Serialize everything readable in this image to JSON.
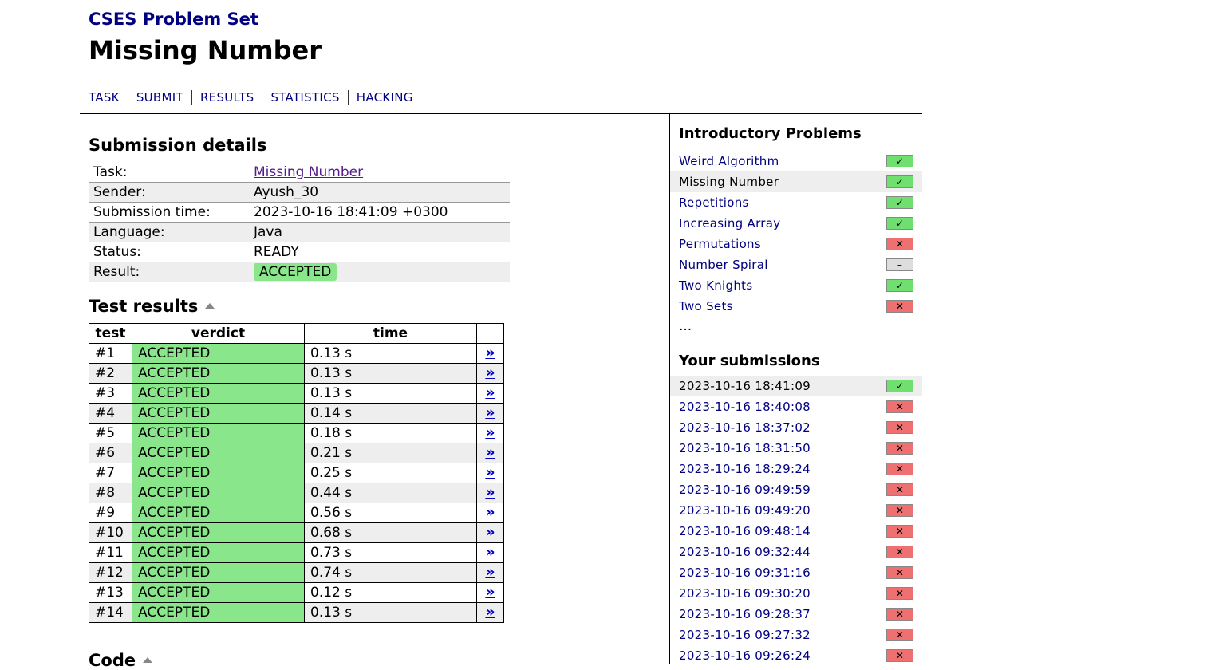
{
  "header": {
    "site_title": "CSES Problem Set",
    "page_title": "Missing Number"
  },
  "nav": [
    {
      "label": "TASK"
    },
    {
      "label": "SUBMIT"
    },
    {
      "label": "RESULTS"
    },
    {
      "label": "STATISTICS"
    },
    {
      "label": "HACKING"
    }
  ],
  "details": {
    "heading": "Submission details",
    "task_label": "Task:",
    "task_value": "Missing Number",
    "sender_label": "Sender:",
    "sender_value": "Ayush_30",
    "time_label": "Submission time:",
    "time_value": "2023-10-16 18:41:09 +0300",
    "language_label": "Language:",
    "language_value": "Java",
    "status_label": "Status:",
    "status_value": "READY",
    "result_label": "Result:",
    "result_value": "ACCEPTED"
  },
  "tests": {
    "heading": "Test results",
    "columns": {
      "test": "test",
      "verdict": "verdict",
      "time": "time"
    },
    "link_glyph": "»",
    "rows": [
      {
        "test": "#1",
        "verdict": "ACCEPTED",
        "time": "0.13 s"
      },
      {
        "test": "#2",
        "verdict": "ACCEPTED",
        "time": "0.13 s"
      },
      {
        "test": "#3",
        "verdict": "ACCEPTED",
        "time": "0.13 s"
      },
      {
        "test": "#4",
        "verdict": "ACCEPTED",
        "time": "0.14 s"
      },
      {
        "test": "#5",
        "verdict": "ACCEPTED",
        "time": "0.18 s"
      },
      {
        "test": "#6",
        "verdict": "ACCEPTED",
        "time": "0.21 s"
      },
      {
        "test": "#7",
        "verdict": "ACCEPTED",
        "time": "0.25 s"
      },
      {
        "test": "#8",
        "verdict": "ACCEPTED",
        "time": "0.44 s"
      },
      {
        "test": "#9",
        "verdict": "ACCEPTED",
        "time": "0.56 s"
      },
      {
        "test": "#10",
        "verdict": "ACCEPTED",
        "time": "0.68 s"
      },
      {
        "test": "#11",
        "verdict": "ACCEPTED",
        "time": "0.73 s"
      },
      {
        "test": "#12",
        "verdict": "ACCEPTED",
        "time": "0.74 s"
      },
      {
        "test": "#13",
        "verdict": "ACCEPTED",
        "time": "0.12 s"
      },
      {
        "test": "#14",
        "verdict": "ACCEPTED",
        "time": "0.13 s"
      }
    ]
  },
  "code": {
    "heading": "Code"
  },
  "sidebar": {
    "problems_heading": "Introductory Problems",
    "problems": [
      {
        "name": "Weird Algorithm",
        "status": "solved"
      },
      {
        "name": "Missing Number",
        "status": "solved"
      },
      {
        "name": "Repetitions",
        "status": "solved"
      },
      {
        "name": "Increasing Array",
        "status": "solved"
      },
      {
        "name": "Permutations",
        "status": "failed"
      },
      {
        "name": "Number Spiral",
        "status": "none"
      },
      {
        "name": "Two Knights",
        "status": "solved"
      },
      {
        "name": "Two Sets",
        "status": "failed"
      }
    ],
    "more": "...",
    "submissions_heading": "Your submissions",
    "submissions": [
      {
        "time": "2023-10-16 18:41:09",
        "status": "solved"
      },
      {
        "time": "2023-10-16 18:40:08",
        "status": "failed"
      },
      {
        "time": "2023-10-16 18:37:02",
        "status": "failed"
      },
      {
        "time": "2023-10-16 18:31:50",
        "status": "failed"
      },
      {
        "time": "2023-10-16 18:29:24",
        "status": "failed"
      },
      {
        "time": "2023-10-16 09:49:59",
        "status": "failed"
      },
      {
        "time": "2023-10-16 09:49:20",
        "status": "failed"
      },
      {
        "time": "2023-10-16 09:48:14",
        "status": "failed"
      },
      {
        "time": "2023-10-16 09:32:44",
        "status": "failed"
      },
      {
        "time": "2023-10-16 09:31:16",
        "status": "failed"
      },
      {
        "time": "2023-10-16 09:30:20",
        "status": "failed"
      },
      {
        "time": "2023-10-16 09:28:37",
        "status": "failed"
      },
      {
        "time": "2023-10-16 09:27:32",
        "status": "failed"
      },
      {
        "time": "2023-10-16 09:26:24",
        "status": "failed"
      }
    ]
  },
  "status_glyphs": {
    "solved": "✓",
    "failed": "✕",
    "none": "–"
  },
  "colors": {
    "accepted": "#8ae68a",
    "solved": "#6fe06f",
    "failed": "#ee7070",
    "link": "#000080"
  }
}
